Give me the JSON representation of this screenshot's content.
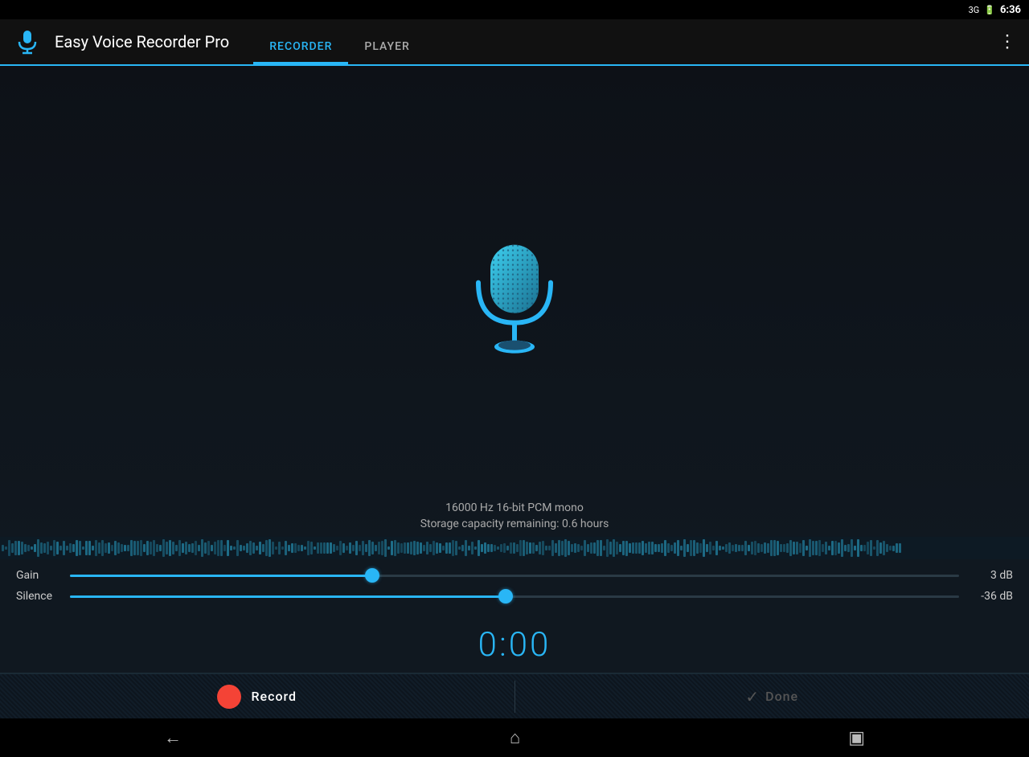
{
  "statusBar": {
    "signal": "3G",
    "battery": "▮▮▮",
    "time": "6:36"
  },
  "appBar": {
    "title": "Easy Voice Recorder Pro",
    "tabs": [
      {
        "id": "recorder",
        "label": "RECORDER",
        "active": true
      },
      {
        "id": "player",
        "label": "PLAYER",
        "active": false
      }
    ],
    "overflow_icon": "⋮"
  },
  "audioInfo": {
    "format": "16000 Hz 16-bit PCM mono",
    "storage": "Storage capacity remaining: 0.6 hours"
  },
  "sliders": {
    "gain": {
      "label": "Gain",
      "value": "3 dB",
      "percent": 34
    },
    "silence": {
      "label": "Silence",
      "value": "-36 dB",
      "percent": 49
    }
  },
  "timer": {
    "display": "0:00"
  },
  "actionBar": {
    "record_label": "Record",
    "done_label": "Done"
  },
  "navBar": {
    "back": "←",
    "home": "⌂",
    "recents": "▣"
  },
  "colors": {
    "accent": "#29b6f6",
    "record_red": "#f44336"
  }
}
